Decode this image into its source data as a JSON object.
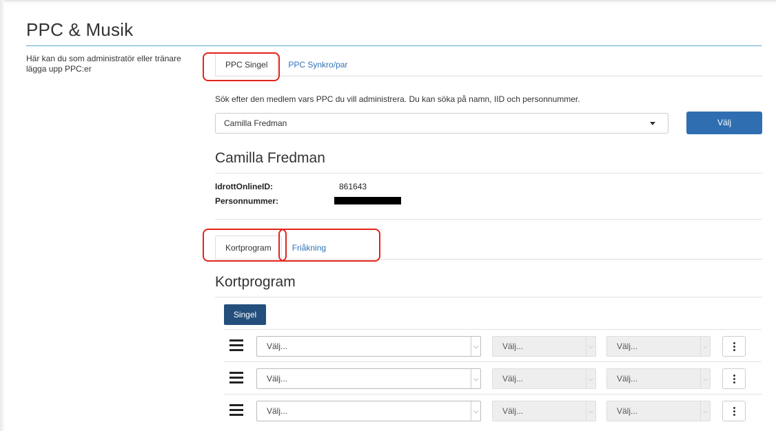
{
  "page": {
    "title": "PPC & Musik"
  },
  "intro": {
    "text": "Här kan du som administratör eller tränare lägga upp PPC:er"
  },
  "ppc_tabs": [
    {
      "label": "PPC Singel",
      "active": true
    },
    {
      "label": "PPC Synkro/par",
      "active": false
    }
  ],
  "search": {
    "hint": "Sök efter den medlem vars PPC du vill administrera. Du kan söka på namn, IID och personnummer.",
    "selected": "Camilla Fredman",
    "button": "Välj"
  },
  "member": {
    "name": "Camilla Fredman",
    "id_label": "IdrottOnlineID:",
    "id_value": "861643",
    "pnr_label": "Personnummer:"
  },
  "program_tabs": [
    {
      "label": "Kortprogram",
      "active": true
    },
    {
      "label": "Friåkning",
      "active": false
    }
  ],
  "section": {
    "title": "Kortprogram",
    "type_button": "Singel"
  },
  "rows": [
    {
      "element": "Välj...",
      "level": "Välj...",
      "variant": "Välj..."
    },
    {
      "element": "Välj...",
      "level": "Välj...",
      "variant": "Välj..."
    },
    {
      "element": "Välj...",
      "level": "Välj...",
      "variant": "Välj..."
    }
  ],
  "colors": {
    "accent": "#2f6fb1",
    "singel": "#244f7d",
    "annotation": "#e2231a",
    "rule": "#5aa7c9"
  },
  "icons": {
    "drag": "drag-handle-icon",
    "menu": "kebab-menu-icon",
    "caret": "chevron-down-icon"
  }
}
